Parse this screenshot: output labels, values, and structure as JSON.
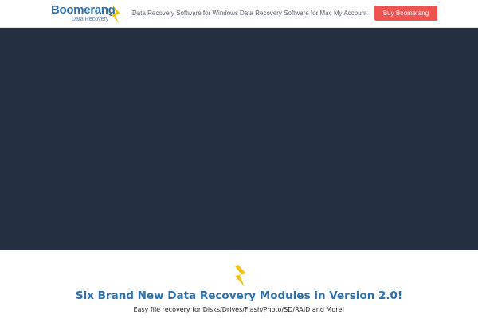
{
  "header": {
    "logo": {
      "name": "Boomerang",
      "tagline": "Data Recovery"
    },
    "nav": {
      "windows_label": "Data Recovery Software for Windows",
      "mac_label": "Data Recovery Software for Mac",
      "account_label": "My Account"
    },
    "buy_label": "Buy Boomerang"
  },
  "hero": {},
  "feature": {
    "icon": "boomerang-bolt-icon",
    "title": "Six Brand New Data Recovery Modules in Version 2.0!",
    "subtitle": "Easy file recovery for Disks/Drives/Flash/Photo/SD/RAID and More!"
  },
  "colors": {
    "brand_blue": "#2a6fb0",
    "brand_yellow": "#f2c318",
    "hero_background": "#233040",
    "buy_button": "#ef5350"
  }
}
